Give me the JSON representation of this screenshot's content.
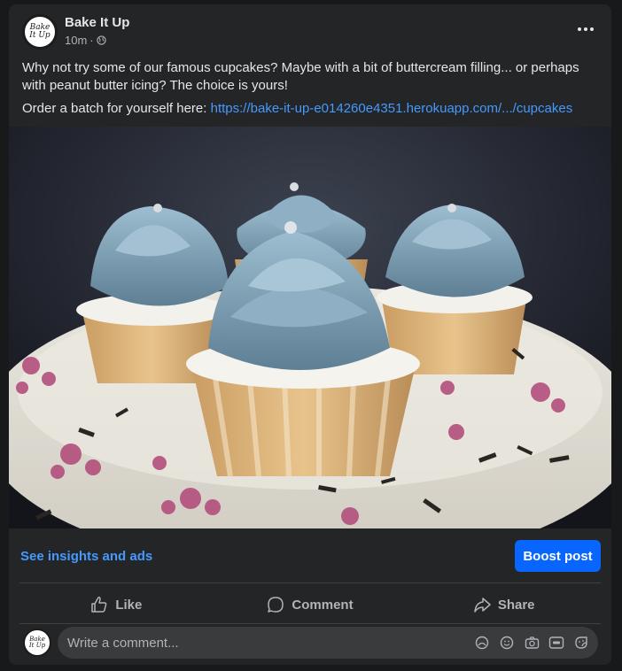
{
  "post": {
    "page_name": "Bake It Up",
    "avatar_text_line1": "Bake",
    "avatar_text_line2": "It Up",
    "time": "10m",
    "separator": "·",
    "text_line1": "Why not try some of our famous cupcakes? Maybe with a bit of buttercream filling... or perhaps with peanut butter icing? The choice is yours!",
    "order_prefix": "Order a batch for yourself here: ",
    "order_link": "https://bake-it-up-e014260e4351.herokuapp.com/.../cupcakes"
  },
  "insights": {
    "link_label": "See insights and ads",
    "boost_label": "Boost post"
  },
  "actions": {
    "like": "Like",
    "comment": "Comment",
    "share": "Share"
  },
  "comment_box": {
    "placeholder": "Write a comment..."
  },
  "colors": {
    "card_bg": "#242526",
    "page_bg": "#18191a",
    "accent_link": "#4599ff",
    "boost_button": "#0866ff",
    "frosting": "#7fa2b8"
  },
  "icons": {
    "more": "more-options-icon",
    "privacy": "globe-icon",
    "like": "thumbs-up-icon",
    "comment": "speech-bubble-icon",
    "share": "share-arrow-icon",
    "comment_tools": [
      "avatar-sticker-icon",
      "emoji-icon",
      "camera-icon",
      "gif-icon",
      "sticker-icon"
    ]
  }
}
